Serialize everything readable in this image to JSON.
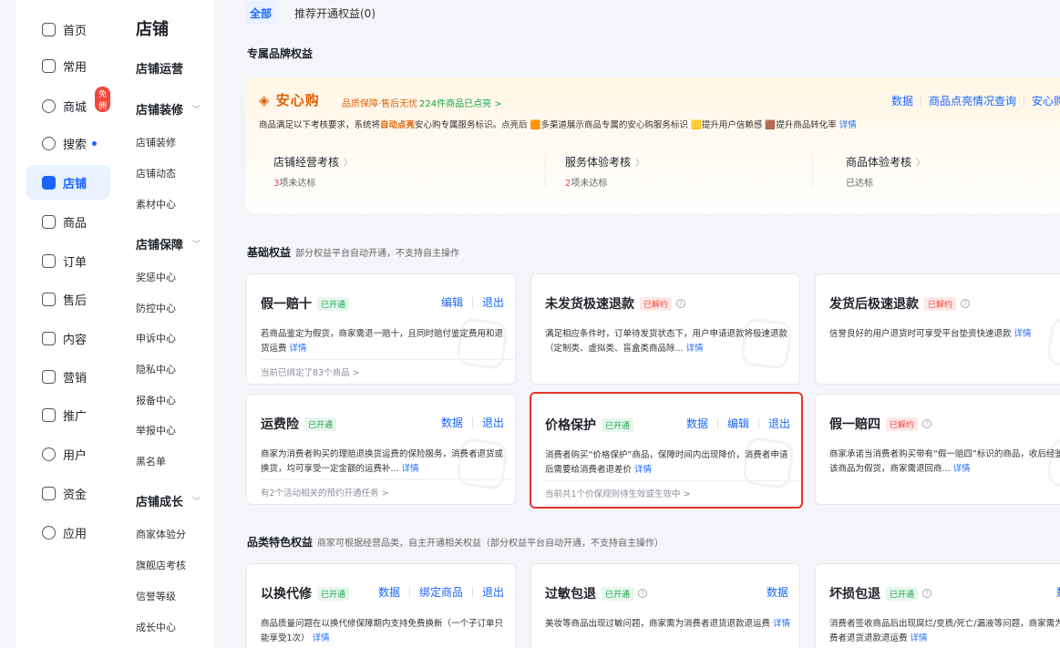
{
  "nav1": {
    "items": [
      {
        "label": "首页",
        "icon": "home-icon"
      },
      {
        "label": "常用",
        "icon": "star-icon"
      },
      {
        "label": "商城",
        "icon": "mall-icon",
        "badge": "免佣"
      },
      {
        "label": "搜索",
        "icon": "search-icon"
      },
      {
        "label": "店铺",
        "icon": "store-icon"
      },
      {
        "label": "商品",
        "icon": "goods-icon"
      },
      {
        "label": "订单",
        "icon": "order-icon"
      },
      {
        "label": "售后",
        "icon": "aftersale-icon"
      },
      {
        "label": "内容",
        "icon": "content-icon"
      },
      {
        "label": "营销",
        "icon": "marketing-icon"
      },
      {
        "label": "推广",
        "icon": "promotion-icon"
      },
      {
        "label": "用户",
        "icon": "user-icon"
      },
      {
        "label": "资金",
        "icon": "wallet-icon"
      },
      {
        "label": "应用",
        "icon": "app-icon"
      }
    ]
  },
  "nav2": {
    "title": "店铺",
    "groups": [
      "店铺运营",
      "店铺装修",
      "店铺保障",
      "店铺成长"
    ],
    "subs": [
      "店铺装修",
      "店铺动态",
      "素材中心",
      "奖惩中心",
      "防控中心",
      "申诉中心",
      "隐私中心",
      "报备中心",
      "举报中心",
      "黑名单",
      "商家体验分",
      "旗舰店考核",
      "信誉等级",
      "成长中心"
    ]
  },
  "tabs": {
    "all": "全部",
    "recommend": "推荐开通权益(0)"
  },
  "sections": {
    "brand": "专属品牌权益",
    "basic": "基础权益",
    "basic_note": "部分权益平台自动开通，不支持自主操作",
    "category": "品类特色权益",
    "category_note": "商家可根据经营品类，自主开通相关权益（部分权益平台自动开通，不支持自主操作）"
  },
  "brand": {
    "logo": "安心购",
    "slogan": "品质保障·售后无忧",
    "highlight": "224件商品已点亮 >",
    "links": [
      "数据",
      "商品点亮情况查询",
      "安心购详"
    ],
    "desc_1": "商品满足以下考核要求，系统将",
    "desc_auto": "自动点亮",
    "desc_2": "安心购专属服务标识。点亮后",
    "desc_3": "多渠道展示商品专属的安心购服务标识",
    "desc_4": "提升用户信赖感",
    "desc_5": "提升商品转化率",
    "desc_more": "详情",
    "checks": [
      {
        "title": "店铺经营考核",
        "num": "3",
        "status": "项未达标"
      },
      {
        "title": "服务体验考核",
        "num": "2",
        "status": "项未达标"
      },
      {
        "title": "商品体验考核",
        "num": "",
        "status": "已达标"
      }
    ]
  },
  "cards": {
    "c1": {
      "title": "假一赔十",
      "tag": "已开通",
      "actions": [
        "编辑",
        "退出"
      ],
      "desc": "若商品鉴定为假货，商家需退一赔十，且同时赔付鉴定费用和退货运费",
      "more": "详情",
      "foot": "当前已绑定了83个商品 >"
    },
    "c2": {
      "title": "未发货极速退款",
      "tag": "已解约",
      "desc": "满足相应条件时，订单待发货状态下，用户申请退款将极速退款（定制类、虚拟类、盲盒类商品除...",
      "more": "详情"
    },
    "c3": {
      "title": "发货后极速退款",
      "tag": "已解约",
      "desc": "信誉良好的用户退货时可享受平台垫资快速退款",
      "more": "详情"
    },
    "c4": {
      "title": "运费险",
      "tag": "已开通",
      "actions": [
        "数据",
        "退出"
      ],
      "desc": "商家为消费者购买的理赔退换货运费的保险服务，消费者退货或换货，均可享受一定金额的运费补...",
      "more": "详情",
      "foot": "有2个活动相关的预约开通任务 >"
    },
    "c5": {
      "title": "价格保护",
      "tag": "已开通",
      "actions": [
        "数据",
        "编辑",
        "退出"
      ],
      "desc": "消费者购买“价格保护”商品，保障时间内出现降价，消费者申请后需要给消费者退差价",
      "more": "详情",
      "foot": "当前共1个价保规则待生效或生效中 >"
    },
    "c6": {
      "title": "假一赔四",
      "tag": "已解约",
      "desc": "商家承诺当消费者购买带有“假一赔四”标识的商品，收后经鉴定该商品为假货，商家需退回商...",
      "more": "详情"
    },
    "c7": {
      "title": "以换代修",
      "tag": "已开通",
      "actions": [
        "数据",
        "绑定商品",
        "退出"
      ],
      "desc": "商品质量问题在以换代修保障期内支持免费换新（一个子订单只能享受1次）",
      "more": "详情"
    },
    "c8": {
      "title": "过敏包退",
      "tag": "已开通",
      "actions": [
        "数据"
      ],
      "desc": "美妆等商品出现过敏问题，商家需为消费者退货退款退运费",
      "more": "详情"
    },
    "c9": {
      "title": "坏损包退",
      "tag": "已开通",
      "actions": [
        "数"
      ],
      "desc": "消费者签收商品后出现腐烂/变质/死亡/漏液等问题，商家需为消费者退货退款退运费",
      "more": "详情"
    }
  }
}
